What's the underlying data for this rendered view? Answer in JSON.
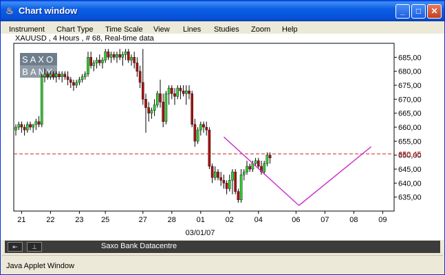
{
  "window": {
    "title": "Chart window",
    "buttons": {
      "minimize": "_",
      "maximize": "□",
      "close": "✕"
    },
    "icon": "java-cup-icon"
  },
  "menu": [
    "Instrument",
    "Chart Type",
    "Time Scale",
    "View",
    "Lines",
    "Studies",
    "Zoom",
    "Help"
  ],
  "chart": {
    "header": "XAUUSD , 4 Hours , # 68, Real-time data",
    "watermark": [
      "SAXO",
      "BANK"
    ],
    "price_label": "650,45",
    "date_label": "03/01/07"
  },
  "statusbar": {
    "text": "Saxo Bank Datacentre",
    "btn1": "⇤",
    "btn2": "⊥"
  },
  "applet": {
    "text": "Java Applet Window"
  },
  "colors": {
    "up": "#33cc33",
    "down": "#aa1111",
    "trend": "#cc33cc",
    "ref": "#cc2222",
    "titlebar": "#0a5ee8"
  },
  "chart_data": {
    "type": "candlestick",
    "instrument": "XAUUSD",
    "ylim": [
      630,
      690
    ],
    "yticks": [
      635,
      640,
      645,
      650,
      655,
      660,
      665,
      670,
      675,
      680,
      685
    ],
    "ytick_labels": [
      "635,00",
      "640,00",
      "645,00",
      "650,00",
      "655,00",
      "660,00",
      "665,00",
      "670,00",
      "675,00",
      "680,00",
      "685,00"
    ],
    "xticks": [
      {
        "i": 2,
        "label": "21"
      },
      {
        "i": 12,
        "label": "22"
      },
      {
        "i": 22,
        "label": "23"
      },
      {
        "i": 31,
        "label": "25"
      },
      {
        "i": 44,
        "label": "27"
      },
      {
        "i": 54,
        "label": "28"
      },
      {
        "i": 64,
        "label": "01"
      },
      {
        "i": 74,
        "label": "02"
      },
      {
        "i": 84,
        "label": "04"
      },
      {
        "i": 97,
        "label": "06"
      },
      {
        "i": 107,
        "label": "07"
      },
      {
        "i": 117,
        "label": "08"
      },
      {
        "i": 127,
        "label": "09"
      }
    ],
    "reference_line": 650.45,
    "candles": [
      [
        659,
        661,
        657,
        660
      ],
      [
        660,
        662,
        659,
        661
      ],
      [
        661,
        662,
        658,
        660
      ],
      [
        660,
        661,
        657,
        659
      ],
      [
        659,
        662,
        658,
        661
      ],
      [
        661,
        662,
        659,
        660
      ],
      [
        660,
        661,
        658,
        661
      ],
      [
        661,
        663,
        659,
        662
      ],
      [
        662,
        664,
        660,
        661
      ],
      [
        661,
        679,
        660,
        678
      ],
      [
        678,
        681,
        676,
        679
      ],
      [
        679,
        680,
        677,
        678
      ],
      [
        678,
        680,
        677,
        679
      ],
      [
        679,
        680,
        677,
        678
      ],
      [
        678,
        680,
        676,
        679
      ],
      [
        679,
        680,
        677,
        678
      ],
      [
        678,
        680,
        676,
        679
      ],
      [
        679,
        680,
        677,
        678
      ],
      [
        678,
        680,
        675,
        677
      ],
      [
        677,
        678,
        674,
        676
      ],
      [
        676,
        677,
        673,
        675
      ],
      [
        675,
        677,
        674,
        676
      ],
      [
        676,
        678,
        675,
        677
      ],
      [
        677,
        679,
        676,
        678
      ],
      [
        678,
        680,
        677,
        679
      ],
      [
        679,
        687,
        678,
        685
      ],
      [
        685,
        687,
        681,
        682
      ],
      [
        682,
        684,
        680,
        683
      ],
      [
        683,
        685,
        681,
        684
      ],
      [
        684,
        686,
        682,
        683
      ],
      [
        683,
        685,
        681,
        684
      ],
      [
        684,
        688,
        683,
        687
      ],
      [
        687,
        688,
        684,
        685
      ],
      [
        685,
        687,
        683,
        686
      ],
      [
        686,
        687,
        684,
        685
      ],
      [
        685,
        687,
        683,
        686
      ],
      [
        686,
        688,
        684,
        685
      ],
      [
        685,
        687,
        682,
        686
      ],
      [
        686,
        688,
        684,
        687
      ],
      [
        687,
        688,
        683,
        684
      ],
      [
        684,
        686,
        682,
        685
      ],
      [
        685,
        687,
        681,
        683
      ],
      [
        683,
        685,
        678,
        680
      ],
      [
        680,
        682,
        674,
        676
      ],
      [
        676,
        688,
        668,
        670
      ],
      [
        670,
        672,
        658,
        667
      ],
      [
        667,
        669,
        662,
        665
      ],
      [
        665,
        667,
        663,
        666
      ],
      [
        666,
        670,
        664,
        668
      ],
      [
        668,
        673,
        667,
        672
      ],
      [
        672,
        677,
        667,
        669
      ],
      [
        669,
        672,
        660,
        662
      ],
      [
        662,
        673,
        661,
        672
      ],
      [
        672,
        675,
        668,
        674
      ],
      [
        674,
        675,
        670,
        672
      ],
      [
        672,
        674,
        668,
        671
      ],
      [
        671,
        675,
        670,
        674
      ],
      [
        674,
        675,
        670,
        673
      ],
      [
        673,
        675,
        671,
        672
      ],
      [
        672,
        675,
        668,
        673
      ],
      [
        673,
        675,
        670,
        672
      ],
      [
        672,
        673,
        660,
        661
      ],
      [
        661,
        663,
        653,
        655
      ],
      [
        655,
        660,
        654,
        659
      ],
      [
        659,
        662,
        657,
        661
      ],
      [
        661,
        662,
        658,
        660
      ],
      [
        660,
        662,
        657,
        659
      ],
      [
        659,
        660,
        645,
        646
      ],
      [
        646,
        647,
        640,
        642
      ],
      [
        642,
        646,
        641,
        644
      ],
      [
        644,
        645,
        641,
        642
      ],
      [
        642,
        644,
        639,
        641
      ],
      [
        641,
        643,
        638,
        640
      ],
      [
        640,
        641,
        636,
        638
      ],
      [
        638,
        643,
        637,
        641
      ],
      [
        641,
        645,
        636,
        644
      ],
      [
        644,
        645,
        636,
        637
      ],
      [
        637,
        638,
        633,
        634
      ],
      [
        634,
        645,
        633,
        643
      ],
      [
        643,
        645,
        641,
        644
      ],
      [
        644,
        648,
        643,
        646
      ],
      [
        646,
        647,
        644,
        645
      ],
      [
        645,
        648,
        644,
        647
      ],
      [
        647,
        649,
        646,
        648
      ],
      [
        648,
        649,
        645,
        646
      ],
      [
        646,
        648,
        643,
        644
      ],
      [
        644,
        648,
        643,
        647
      ],
      [
        647,
        651,
        646,
        650
      ],
      [
        650,
        651,
        647,
        649
      ]
    ],
    "trendlines": [
      {
        "from": [
          72,
          656.5
        ],
        "to": [
          98,
          632
        ]
      },
      {
        "from": [
          98,
          632
        ],
        "to": [
          123,
          653
        ]
      }
    ]
  }
}
